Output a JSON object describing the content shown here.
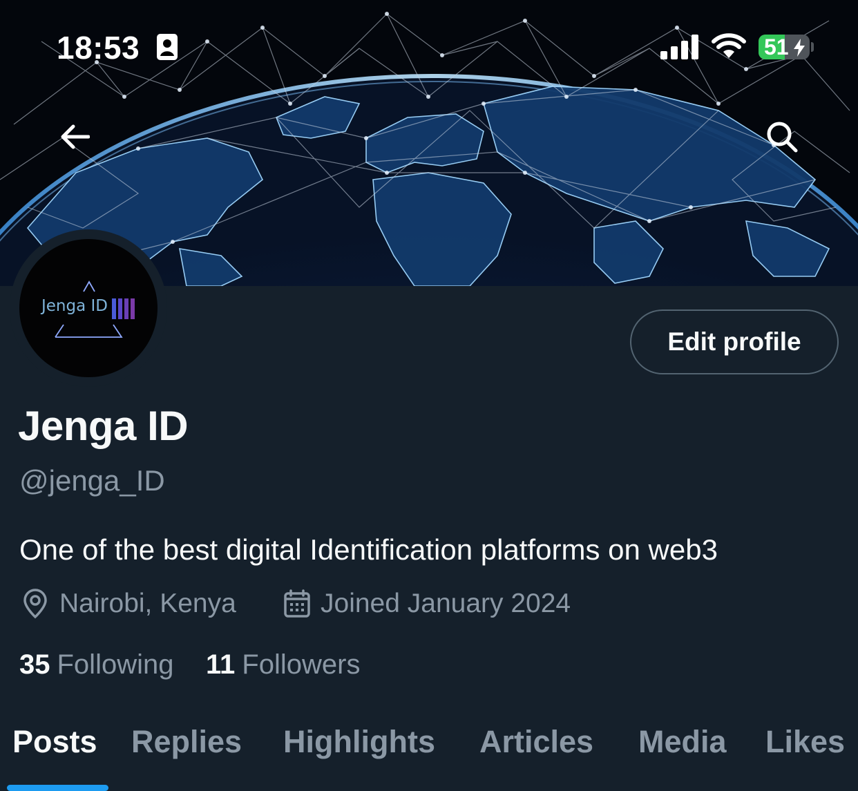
{
  "status_bar": {
    "time": "18:53",
    "battery_level": "51",
    "icons": [
      "contact-card-icon",
      "signal-icon",
      "wifi-icon",
      "battery-icon",
      "charging-bolt-icon"
    ]
  },
  "header": {
    "back_icon": "arrow-left-icon",
    "search_icon": "search-icon",
    "banner": "globe-network-banner"
  },
  "profile": {
    "avatar_text": "Jenga ID",
    "edit_label": "Edit profile",
    "display_name": "Jenga ID",
    "handle": "@jenga_ID",
    "bio": "One of the best digital Identification platforms on web3",
    "location": "Nairobi, Kenya",
    "joined": "Joined January 2024",
    "following_count": "35",
    "following_label": "Following",
    "followers_count": "11",
    "followers_label": "Followers"
  },
  "tabs": [
    {
      "label": "Posts",
      "active": true
    },
    {
      "label": "Replies",
      "active": false
    },
    {
      "label": "Highlights",
      "active": false
    },
    {
      "label": "Articles",
      "active": false
    },
    {
      "label": "Media",
      "active": false
    },
    {
      "label": "Likes",
      "active": false
    }
  ],
  "colors": {
    "background": "#15202b",
    "accent": "#1d9bf0",
    "secondary_text": "#8b98a5",
    "battery_green": "#34c759"
  }
}
